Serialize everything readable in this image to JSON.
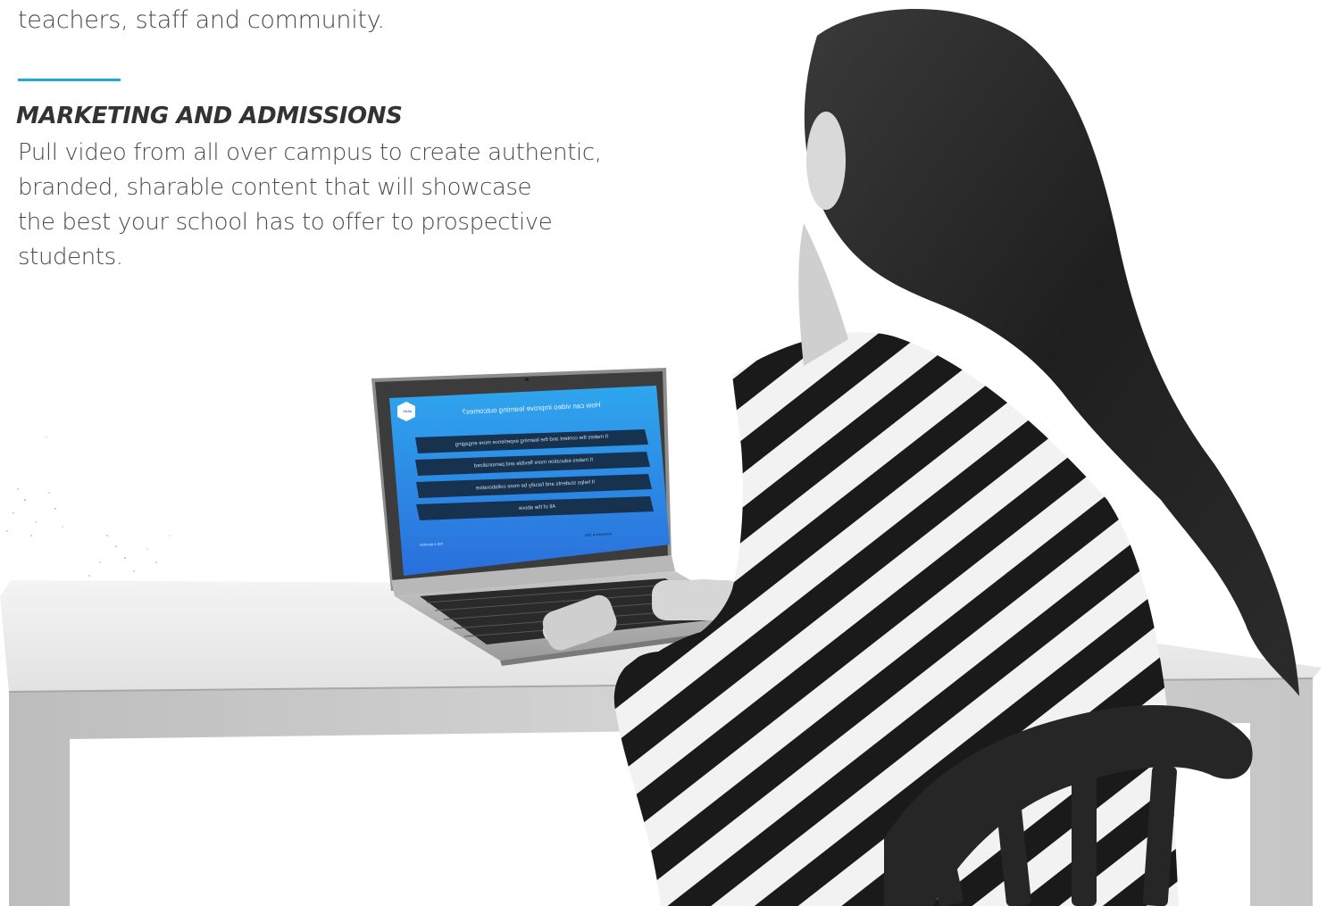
{
  "intro": {
    "fragment": "teachers, staff and community."
  },
  "section": {
    "heading": "MARKETING AND ADMISSIONS",
    "body_lines": [
      "Pull video from all over campus to create authentic,",
      "branded, sharable content that will showcase",
      "the best your school has to offer to prospective",
      "students."
    ]
  },
  "colors": {
    "accent": "#1fa9d6",
    "heading": "#333333",
    "body": "#4a4a4a"
  },
  "photo": {
    "description": "",
    "laptop_screen": {
      "question": "How can video improve learning outcomes?",
      "options": [
        "It makes the content and the learning experience more engaging",
        "It makes education more flexible and personalized",
        "It helps students and faculty be more collaborative",
        "All of the above"
      ],
      "footer_left": "Ask a question",
      "footer_right": "Answered  ●  Skip",
      "logo": "YuJa"
    }
  }
}
